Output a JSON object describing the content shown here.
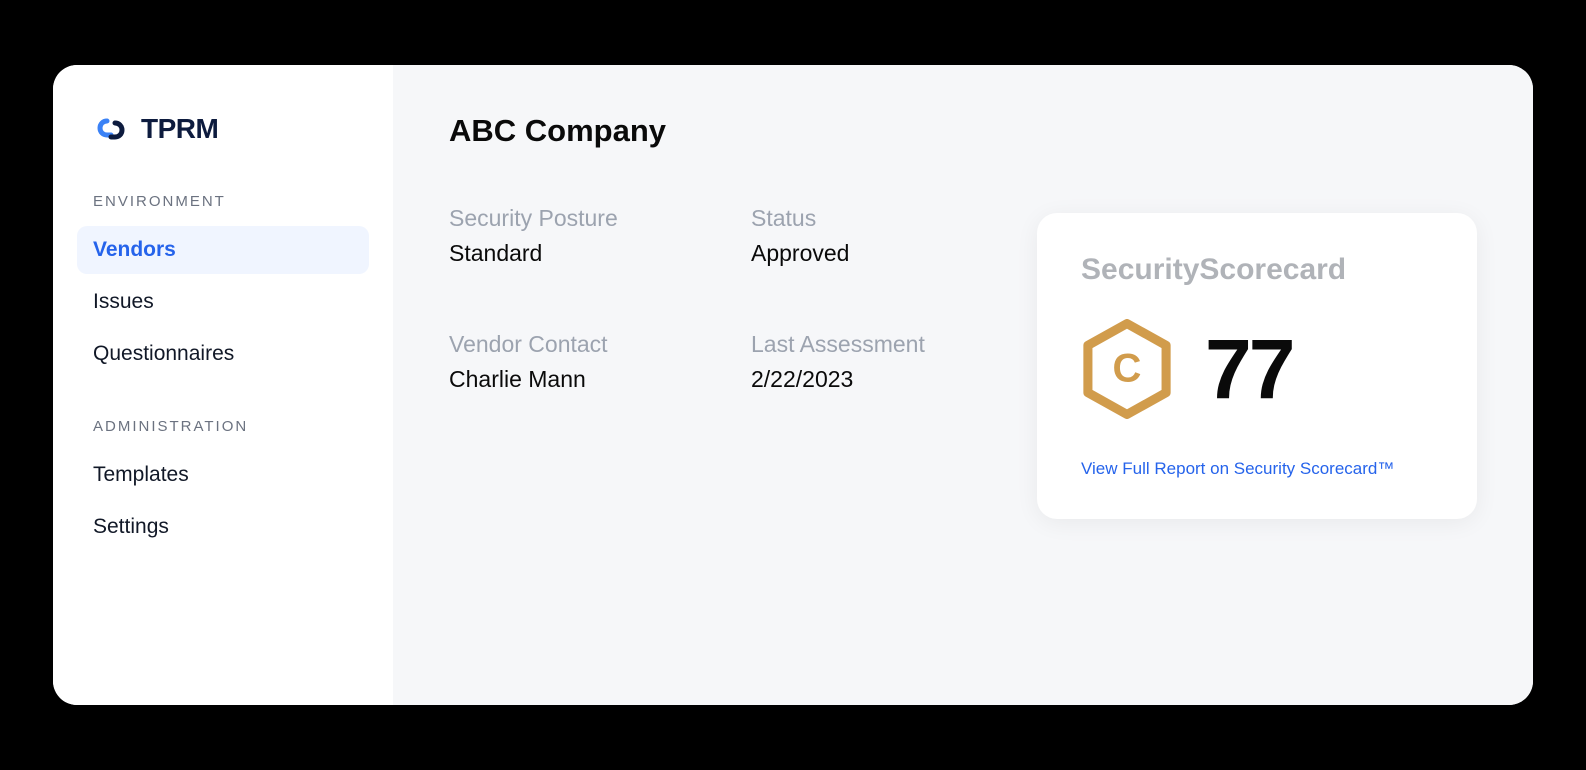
{
  "brand": {
    "name": "TPRM"
  },
  "sidebar": {
    "sections": [
      {
        "header": "ENVIRONMENT",
        "items": [
          {
            "label": "Vendors",
            "active": true
          },
          {
            "label": "Issues",
            "active": false
          },
          {
            "label": "Questionnaires",
            "active": false
          }
        ]
      },
      {
        "header": "ADMINISTRATION",
        "items": [
          {
            "label": "Templates",
            "active": false
          },
          {
            "label": "Settings",
            "active": false
          }
        ]
      }
    ]
  },
  "main": {
    "title": "ABC Company",
    "info": {
      "security_posture": {
        "label": "Security Posture",
        "value": "Standard"
      },
      "status": {
        "label": "Status",
        "value": "Approved"
      },
      "vendor_contact": {
        "label": "Vendor Contact",
        "value": "Charlie Mann"
      },
      "last_assessment": {
        "label": "Last Assessment",
        "value": "2/22/2023"
      }
    }
  },
  "scorecard": {
    "title": "SecurityScorecard",
    "grade": "C",
    "score": "77",
    "link_text": "View Full Report on Security Scorecard™",
    "badge_color": "#d19c4c"
  }
}
